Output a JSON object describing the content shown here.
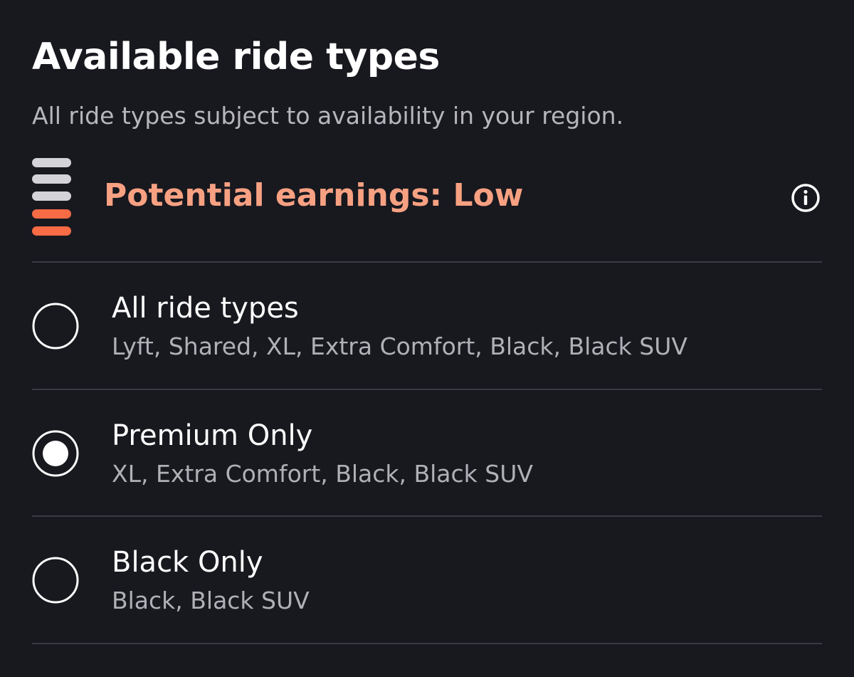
{
  "header": {
    "title": "Available ride types",
    "subtitle": "All ride types subject to availability in your region."
  },
  "earnings": {
    "label": "Potential earnings: Low",
    "level": "Low",
    "meter_filled_segments": 2,
    "meter_total_segments": 5,
    "accent_color": "#f7a182",
    "meter_filled_color": "#f76b45",
    "meter_empty_color": "#d4d4d8",
    "info_icon": "info-circle-icon"
  },
  "options": [
    {
      "title": "All ride types",
      "description": "Lyft, Shared, XL, Extra Comfort, Black, Black SUV",
      "selected": false
    },
    {
      "title": "Premium Only",
      "description": "XL, Extra Comfort, Black, Black SUV",
      "selected": true
    },
    {
      "title": "Black Only",
      "description": "Black, Black SUV",
      "selected": false
    }
  ],
  "colors": {
    "background": "#18181f",
    "divider": "#3a3a42",
    "text_primary": "#ffffff",
    "text_secondary": "#b0b0b6"
  }
}
